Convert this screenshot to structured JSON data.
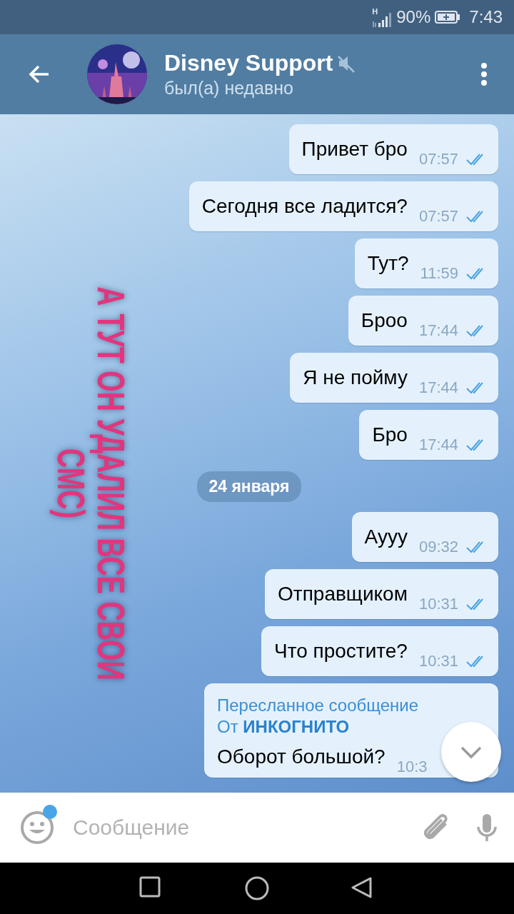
{
  "status_bar": {
    "network": "H",
    "battery": "90%",
    "time": "7:43"
  },
  "header": {
    "title": "Disney Support",
    "muted": true,
    "subtitle": "был(а) недавно"
  },
  "messages": [
    {
      "kind": "text",
      "text": "Привет бро",
      "time": "07:57",
      "read": true
    },
    {
      "kind": "text",
      "text": "Сегодня все ладится?",
      "time": "07:57",
      "read": true
    },
    {
      "kind": "text",
      "text": "Тут?",
      "time": "11:59",
      "read": true
    },
    {
      "kind": "text",
      "text": "Броо",
      "time": "17:44",
      "read": true
    },
    {
      "kind": "text",
      "text": "Я не пойму",
      "time": "17:44",
      "read": true
    },
    {
      "kind": "text",
      "text": "Бро",
      "time": "17:44",
      "read": true
    },
    {
      "kind": "date",
      "text": "24 января"
    },
    {
      "kind": "text",
      "text": "Аууу",
      "time": "09:32",
      "read": true
    },
    {
      "kind": "text",
      "text": "Отправщиком",
      "time": "10:31",
      "read": true
    },
    {
      "kind": "text",
      "text": "Что простите?",
      "time": "10:31",
      "read": true
    },
    {
      "kind": "forwarded",
      "label": "Пересланное сообщение",
      "from": "От **ИНКОГНИТО**",
      "text": "Оборот большой?",
      "time": "10:3"
    }
  ],
  "overlay": {
    "lines": [
      "А ТУТ ОН УДАЛИЛ ВСЕ СВОИ",
      "СМС)"
    ]
  },
  "input": {
    "placeholder": "Сообщение",
    "emoji_badge": true
  }
}
